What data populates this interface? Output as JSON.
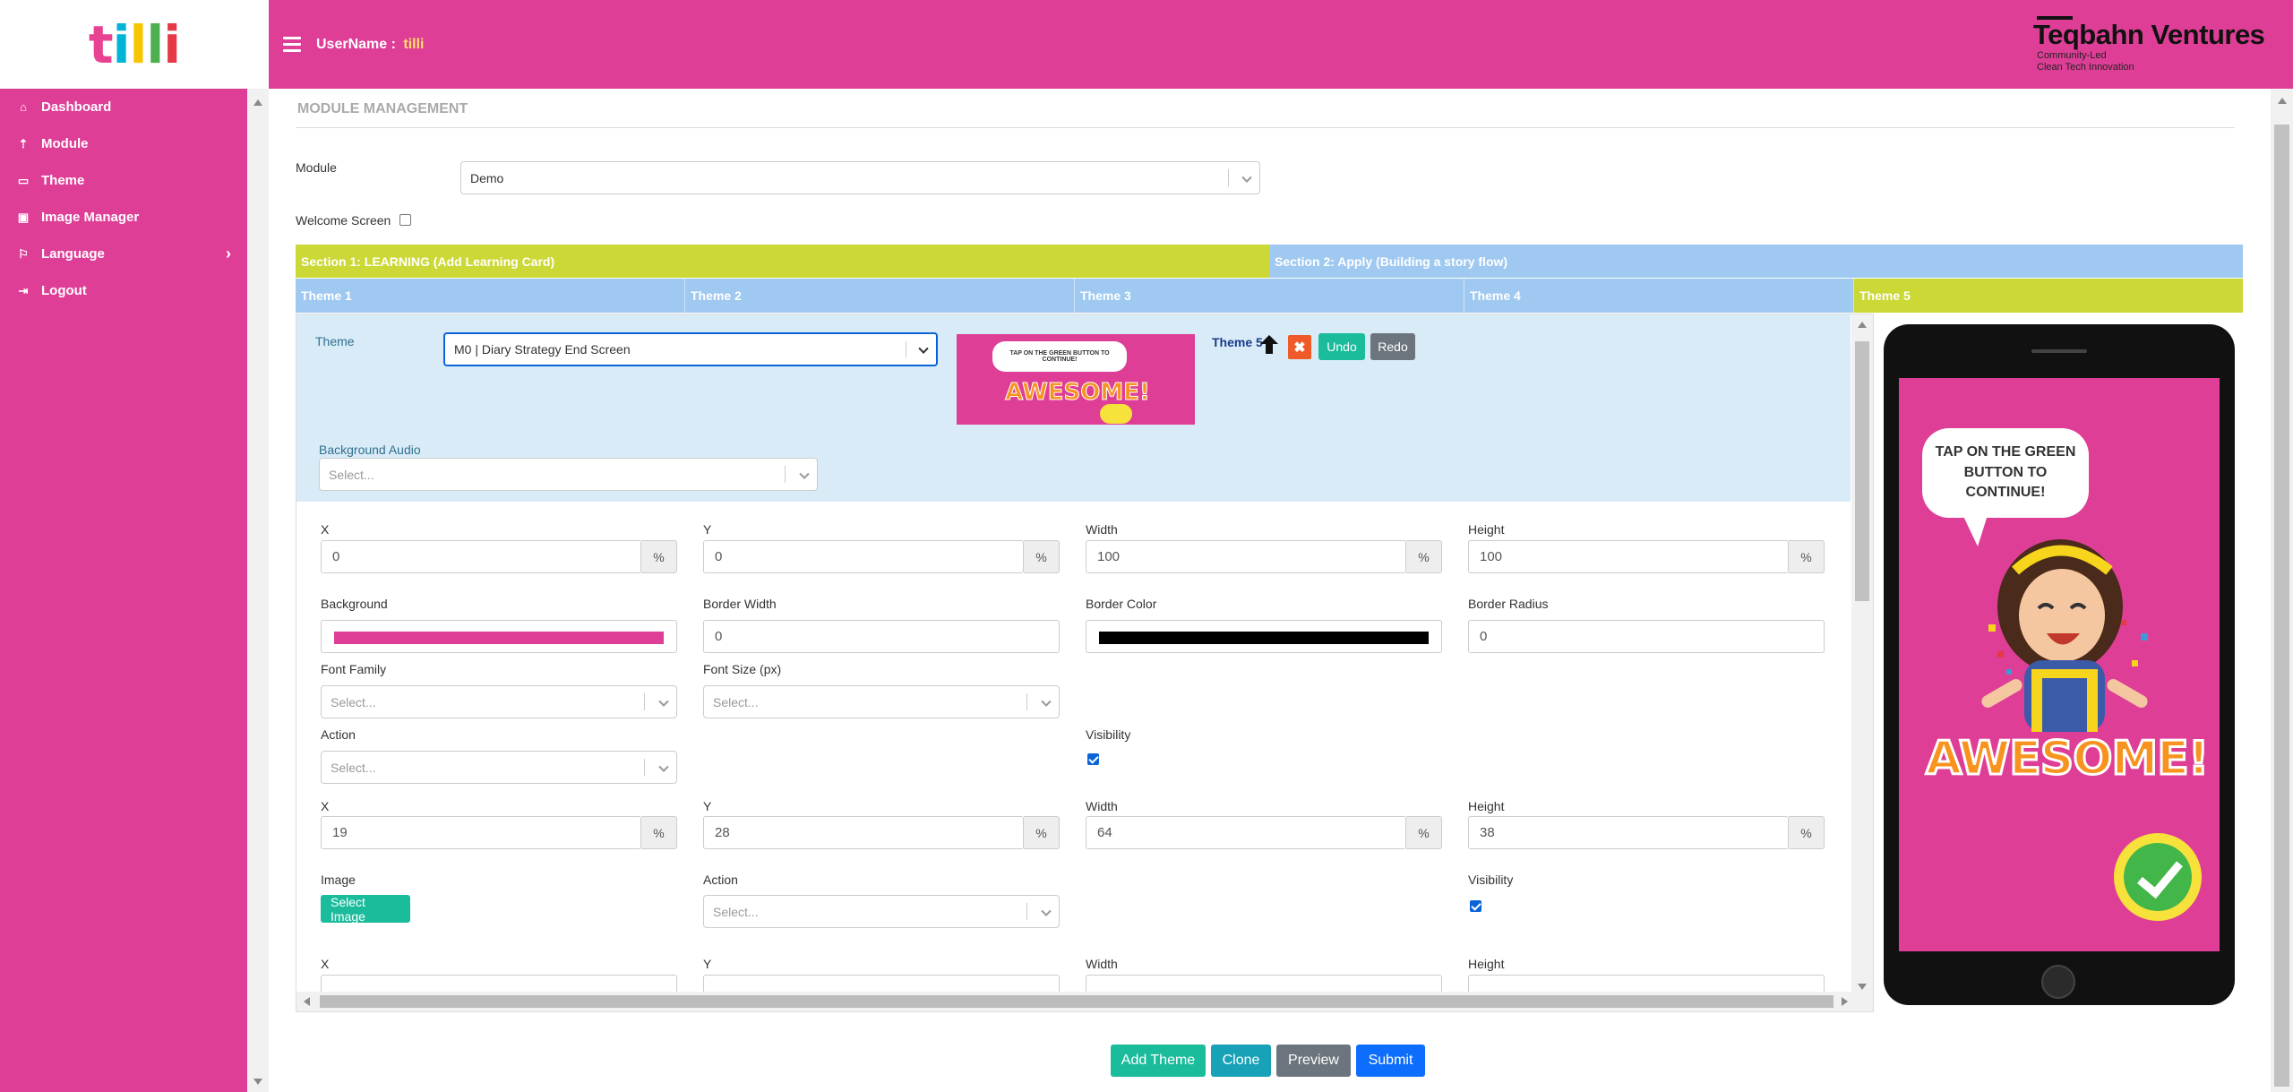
{
  "app": {
    "logo_text": "tilli"
  },
  "header": {
    "username_label": "UserName :",
    "username_value": "tilli",
    "brand_name": "Teqbahn Ventures",
    "brand_tagline_1": "Community-Led",
    "brand_tagline_2": "Clean Tech Innovation"
  },
  "sidebar": {
    "items": [
      {
        "label": "Dashboard",
        "icon": "home-icon"
      },
      {
        "label": "Module",
        "icon": "upload-icon"
      },
      {
        "label": "Theme",
        "icon": "monitor-icon"
      },
      {
        "label": "Image Manager",
        "icon": "image-icon"
      },
      {
        "label": "Language",
        "icon": "language-icon",
        "has_submenu": true
      },
      {
        "label": "Logout",
        "icon": "logout-icon"
      }
    ]
  },
  "page": {
    "title": "MODULE MANAGEMENT",
    "module_label": "Module",
    "module_value": "Demo",
    "welcome_label": "Welcome Screen",
    "welcome_checked": false
  },
  "sections": [
    {
      "label": "Section 1: LEARNING (Add Learning Card)",
      "active": true
    },
    {
      "label": "Section 2: Apply (Building a story flow)",
      "active": false
    }
  ],
  "themes": [
    {
      "label": "Theme 1"
    },
    {
      "label": "Theme 2"
    },
    {
      "label": "Theme 3"
    },
    {
      "label": "Theme 4"
    },
    {
      "label": "Theme 5",
      "active": true
    }
  ],
  "editor": {
    "theme_label": "Theme",
    "theme_value": "M0 | Diary Strategy End Screen",
    "current_theme": "Theme 5",
    "undo_label": "Undo",
    "redo_label": "Redo",
    "bg_audio_label": "Background Audio",
    "bg_audio_placeholder": "Select...",
    "thumbnail_text": "AWESOME!",
    "thumbnail_bubble": "TAP ON THE GREEN BUTTON TO CONTINUE!",
    "element1": {
      "x_label": "X",
      "x_value": "0",
      "y_label": "Y",
      "y_value": "0",
      "w_label": "Width",
      "w_value": "100",
      "h_label": "Height",
      "h_value": "100",
      "unit": "%",
      "bg_label": "Background",
      "bg_color": "#df3e97",
      "bw_label": "Border Width",
      "bw_value": "0",
      "bc_label": "Border Color",
      "bc_color": "#000000",
      "br_label": "Border Radius",
      "br_value": "0",
      "ff_label": "Font Family",
      "ff_placeholder": "Select...",
      "fs_label": "Font Size (px)",
      "fs_placeholder": "Select...",
      "action_label": "Action",
      "action_placeholder": "Select...",
      "visibility_label": "Visibility",
      "visibility_checked": true
    },
    "element2": {
      "x_label": "X",
      "x_value": "19",
      "y_label": "Y",
      "y_value": "28",
      "w_label": "Width",
      "w_value": "64",
      "h_label": "Height",
      "h_value": "38",
      "unit": "%",
      "image_label": "Image",
      "select_image_label": "Select Image",
      "action_label": "Action",
      "action_placeholder": "Select...",
      "visibility_label": "Visibility",
      "visibility_checked": true
    },
    "element3": {
      "x_label": "X",
      "y_label": "Y",
      "w_label": "Width",
      "h_label": "Height"
    }
  },
  "preview": {
    "bubble_text_1": "TAP ON THE GREEN",
    "bubble_text_2": "BUTTON TO CONTINUE!",
    "awesome_text": "AWESOME!",
    "bg_color": "#df3e97"
  },
  "actions": {
    "add_theme": "Add Theme",
    "clone": "Clone",
    "preview": "Preview",
    "submit": "Submit"
  },
  "colors": {
    "brand_pink": "#df3e97",
    "section_active": "#cbd835",
    "section_inactive": "#9fc9f0",
    "teal": "#1abc9c",
    "submit_blue": "#0d6efd"
  }
}
